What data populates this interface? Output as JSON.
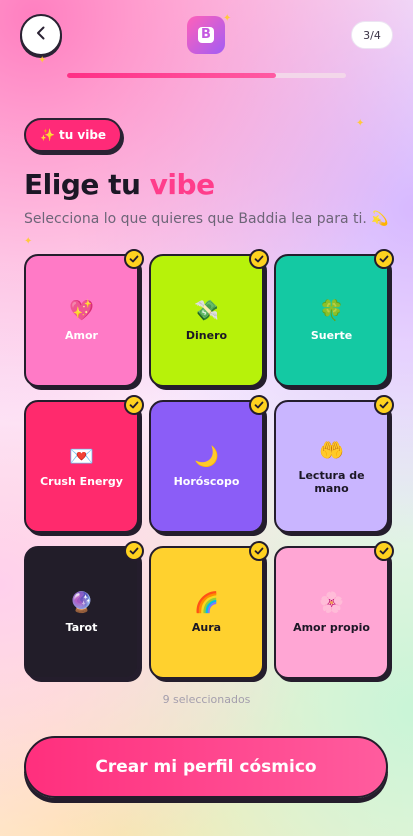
{
  "header": {
    "back_icon": "chevron-left-icon",
    "logo_letter": "B",
    "step": "3/4",
    "progress": 0.75
  },
  "chip": {
    "icon": "✨",
    "label": "tu vibe"
  },
  "title": {
    "part1": "Elige tu ",
    "accent": "vibe"
  },
  "subtitle": "Selecciona lo que quieres que Baddia lea para ti. 💫",
  "cards": [
    {
      "label": "Amor",
      "emoji": "💖",
      "bg": "#ff7ac6",
      "text": "#ffffff",
      "selected": true
    },
    {
      "label": "Dinero",
      "emoji": "💸",
      "bg": "#b7f20a",
      "text": "#1c1726",
      "selected": true
    },
    {
      "label": "Suerte",
      "emoji": "🍀",
      "bg": "#14c9a3",
      "text": "#ffffff",
      "selected": true
    },
    {
      "label": "Crush Energy",
      "emoji": "💌",
      "bg": "#ff2a6d",
      "text": "#ffffff",
      "selected": true
    },
    {
      "label": "Horóscopo",
      "emoji": "🌙",
      "bg": "#8b5df7",
      "text": "#ffffff",
      "selected": true
    },
    {
      "label": "Lectura de mano",
      "emoji": "🤲",
      "bg": "#c9b5ff",
      "text": "#1c1726",
      "selected": true
    },
    {
      "label": "Tarot",
      "emoji": "🔮",
      "bg": "#221d29",
      "text": "#ffffff",
      "selected": true
    },
    {
      "label": "Aura",
      "emoji": "🌈",
      "bg": "#ffd12e",
      "text": "#1c1726",
      "selected": true
    },
    {
      "label": "Amor propio",
      "emoji": "🌸",
      "bg": "#ffa6d4",
      "text": "#1c1726",
      "selected": true
    }
  ],
  "count_label": "9 seleccionados",
  "cta_label": "Crear mi perfil cósmico"
}
